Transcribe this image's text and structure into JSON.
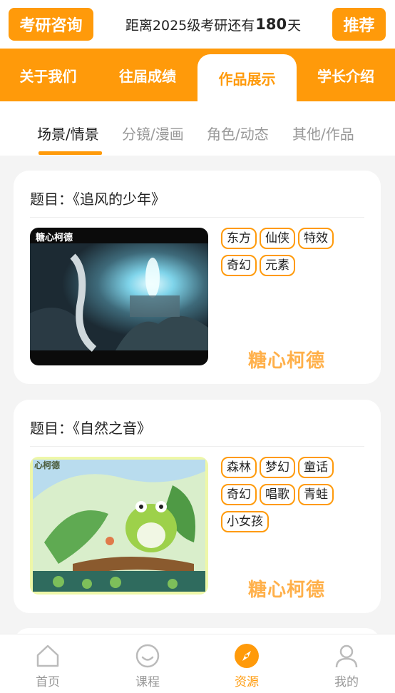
{
  "header": {
    "left_button": "考研咨询",
    "countdown_prefix": "距离2025级考研还有",
    "countdown_days": "180",
    "countdown_suffix": "天",
    "right_button": "推荐"
  },
  "main_tabs": [
    {
      "label": "关于我们"
    },
    {
      "label": "往届成绩"
    },
    {
      "label": "作品展示",
      "active": true
    },
    {
      "label": "学长介绍"
    }
  ],
  "sub_tabs": [
    {
      "label": "场景/情景",
      "active": true
    },
    {
      "label": "分镜/漫画"
    },
    {
      "label": "角色/动态"
    },
    {
      "label": "其他/作品"
    }
  ],
  "cards": [
    {
      "title": "题目：《追风的少年》",
      "image_watermark": "糖心柯德",
      "tags": [
        "东方",
        "仙侠",
        "特效",
        "奇幻",
        "元素"
      ],
      "brand": "糖心柯德"
    },
    {
      "title": "题目：《自然之音》",
      "image_watermark": "心柯德",
      "tags": [
        "森林",
        "梦幻",
        "童话",
        "奇幻",
        "唱歌",
        "青蛙",
        "小女孩"
      ],
      "brand": "糖心柯德"
    }
  ],
  "bottom_nav": [
    {
      "label": "首页",
      "icon": "home-icon"
    },
    {
      "label": "课程",
      "icon": "smile-icon"
    },
    {
      "label": "资源",
      "icon": "compass-icon",
      "active": true
    },
    {
      "label": "我的",
      "icon": "user-icon"
    }
  ],
  "colors": {
    "accent": "#ff9a0a",
    "muted": "#999999"
  }
}
